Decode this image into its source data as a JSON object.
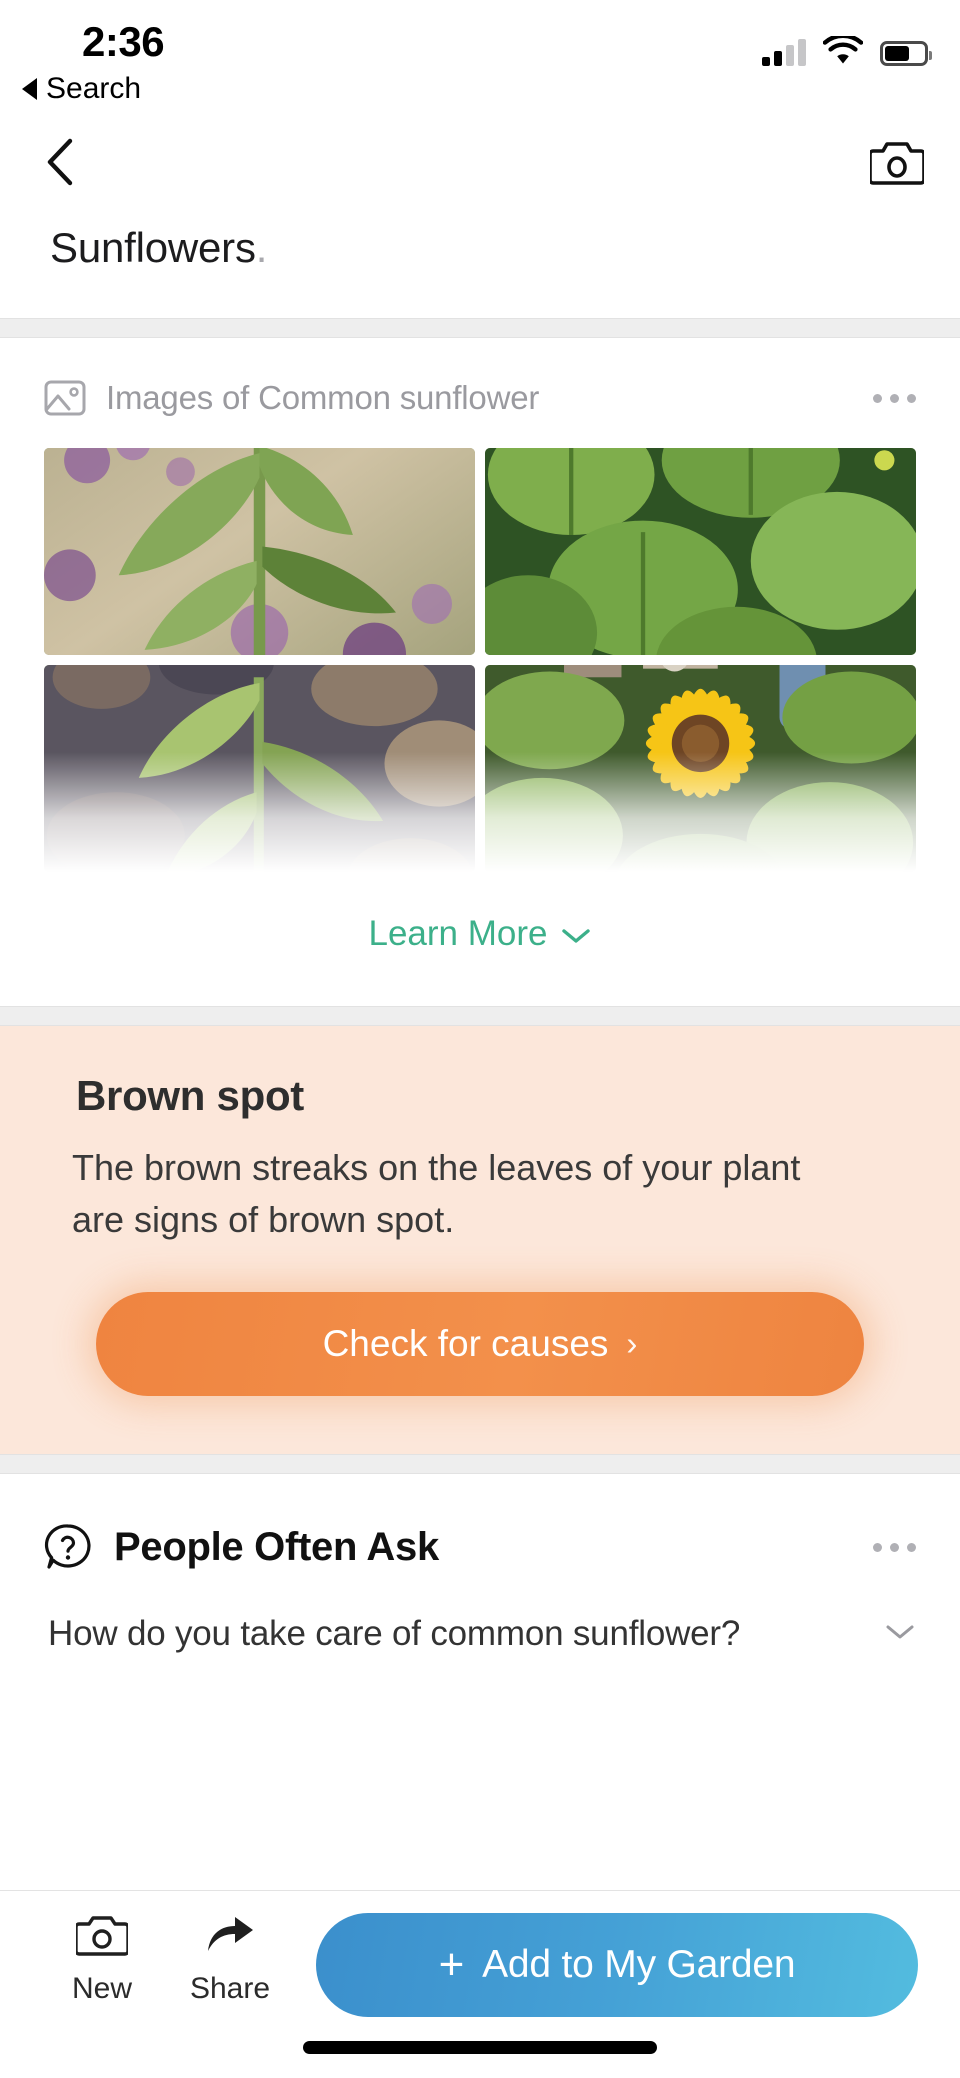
{
  "status_bar": {
    "time": "2:36",
    "back_label": "Search",
    "signal_icon": "cellular-signal-icon",
    "wifi_icon": "wifi-icon",
    "battery_icon": "battery-icon",
    "signal_bars_filled": 2,
    "signal_bars_total": 4,
    "battery_level_pct": 58
  },
  "nav_bar": {
    "back_icon": "chevron-left-icon",
    "camera_icon": "camera-icon"
  },
  "page": {
    "title": "Sunflowers",
    "title_punctuation": "."
  },
  "images_card": {
    "icon": "photo-icon",
    "header": "Images of Common sunflower",
    "overflow_icon": "ellipsis-icon",
    "tiles": [
      {
        "alt": "sunflower-plant-with-purple-flowers"
      },
      {
        "alt": "sunflower-leaves-closeup-green"
      },
      {
        "alt": "young-sunflower-seedling-on-rocks"
      },
      {
        "alt": "blooming-yellow-sunflower-in-garden"
      }
    ],
    "learn_more": "Learn More",
    "learn_more_icon": "chevron-down-icon"
  },
  "alert_card": {
    "title": "Brown spot",
    "body": "The brown streaks on the leaves of your plant are signs of brown spot.",
    "cta_label": "Check for causes",
    "cta_chevron": "›",
    "background_color": "#fce7da",
    "accent_color": "#ef8440"
  },
  "faq_card": {
    "icon": "question-bubble-icon",
    "title": "People Often Ask",
    "overflow_icon": "ellipsis-icon",
    "questions": [
      {
        "text": "How do you take care of common sunflower?",
        "chevron_icon": "chevron-down-icon"
      }
    ]
  },
  "bottom_bar": {
    "tools": [
      {
        "label": "New",
        "icon": "camera-icon"
      },
      {
        "label": "Share",
        "icon": "share-arrow-icon"
      }
    ],
    "primary_button": {
      "plus": "+",
      "label": "Add to My Garden",
      "color_start": "#3b8fcc",
      "color_end": "#53bcdf"
    }
  },
  "colors": {
    "learn_more": "#3cb08a",
    "divider": "#eeeeee"
  }
}
